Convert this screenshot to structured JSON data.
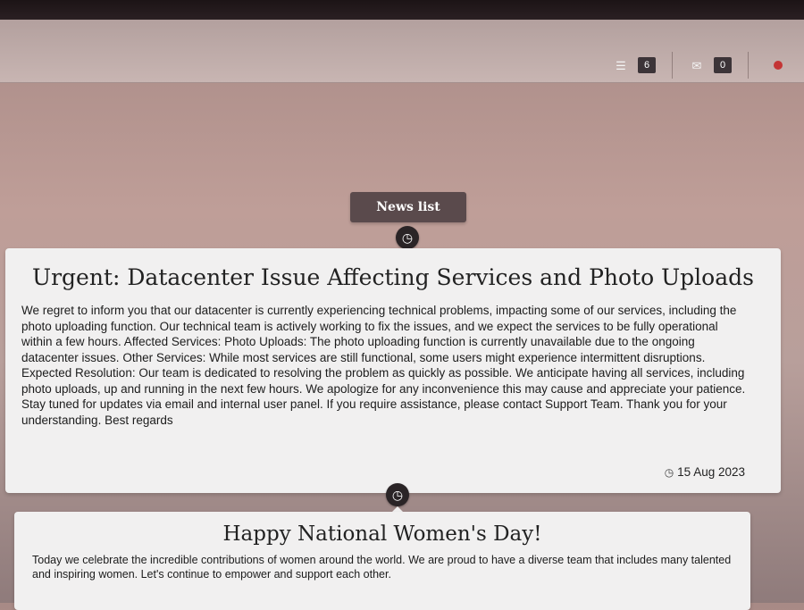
{
  "header": {
    "icons": [
      {
        "name": "news-list-icon",
        "glyph": "☰",
        "count": "6"
      },
      {
        "name": "mail-icon",
        "glyph": "✉",
        "count": "0"
      }
    ]
  },
  "news_list_button": "News list",
  "timeline_icon": "clock-icon",
  "posts": [
    {
      "title": "Urgent: Datacenter Issue Affecting Services and Photo Uploads",
      "body": "We regret to inform you that our datacenter is currently experiencing technical problems, impacting some of our services, including the photo uploading function. Our technical team is actively working to fix the issues, and we expect the services to be fully operational within a few hours. Affected Services: Photo Uploads: The photo uploading function is currently unavailable due to the ongoing datacenter issues. Other Services: While most services are still functional, some users might experience intermittent disruptions. Expected Resolution: Our team is dedicated to resolving the problem as quickly as possible. We anticipate having all services, including photo uploads, up and running in the next few hours. We apologize for any inconvenience this may cause and appreciate your patience. Stay tuned for updates via email and internal user panel. If you require assistance, please contact Support Team. Thank you for your understanding. Best regards",
      "date": "15 Aug 2023"
    },
    {
      "title": "Happy National Women's Day!",
      "body": "Today we celebrate the incredible contributions of women around the world. We are proud to have a diverse team that includes many talented and inspiring women. Let's continue to empower and support each other."
    }
  ]
}
